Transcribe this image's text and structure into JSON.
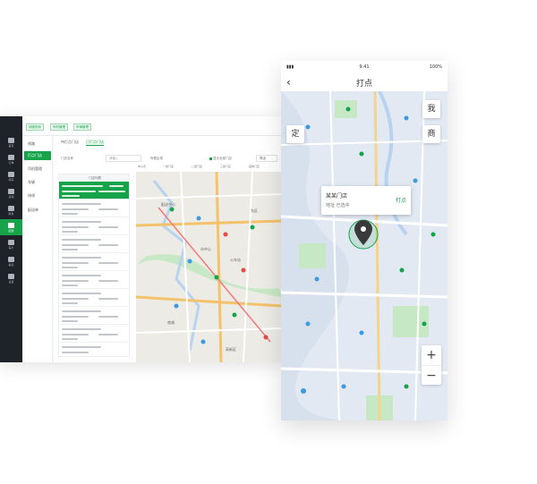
{
  "desktop": {
    "nav_items": [
      {
        "label": "首页",
        "icon": "home-icon"
      },
      {
        "label": "订单",
        "icon": "order-icon"
      },
      {
        "label": "库存",
        "icon": "warehouse-icon"
      },
      {
        "label": "采购",
        "icon": "cart-icon"
      },
      {
        "label": "财务",
        "icon": "finance-icon"
      },
      {
        "label": "配送",
        "icon": "delivery-icon"
      },
      {
        "label": "客户",
        "icon": "customer-icon"
      },
      {
        "label": "报表",
        "icon": "report-icon"
      },
      {
        "label": "设置",
        "icon": "settings-icon"
      }
    ],
    "nav_active_index": 5,
    "page_tabs": [
      "线路规划",
      "司机管理",
      "车辆管理"
    ],
    "sub_items": [
      {
        "label": "线路"
      },
      {
        "label": "打点门店"
      },
      {
        "label": "司机管理"
      },
      {
        "label": "车辆"
      },
      {
        "label": "排线"
      },
      {
        "label": "配送单"
      }
    ],
    "sub_active_index": 1,
    "content_tabs": [
      "待打点门店",
      "已打点门店"
    ],
    "content_active_index": 1,
    "filters": {
      "name_label": "门店名称",
      "search_placeholder": "请输入",
      "region_label": "所属区域",
      "checkbox_label": "显示全部门店",
      "button_label": "导出"
    },
    "list_header": "门店列表",
    "legend": [
      "中心仓",
      "一级门店",
      "二级门店",
      "三级门店",
      "其他门店"
    ],
    "map_labels": [
      "配送中心",
      "市中心",
      "火车站",
      "东区",
      "南湖",
      "高新区"
    ]
  },
  "phone": {
    "status": {
      "time": "9:41",
      "battery": "100%"
    },
    "title": "打点",
    "map_buttons": [
      {
        "label": "我",
        "icon": "locate-me-icon"
      },
      {
        "label": "定",
        "icon": "position-icon"
      },
      {
        "label": "商",
        "icon": "store-icon"
      }
    ],
    "popup": {
      "name": "某某门店",
      "index": "地址 已选中",
      "action": "打点"
    },
    "zoom": {
      "in": "+",
      "out": "−"
    },
    "colors": {
      "accent": "#16a34a",
      "water": "#b7d3f0",
      "park": "#c7e8c4",
      "road": "#ffffff",
      "marker": "#3b9ae1"
    }
  }
}
